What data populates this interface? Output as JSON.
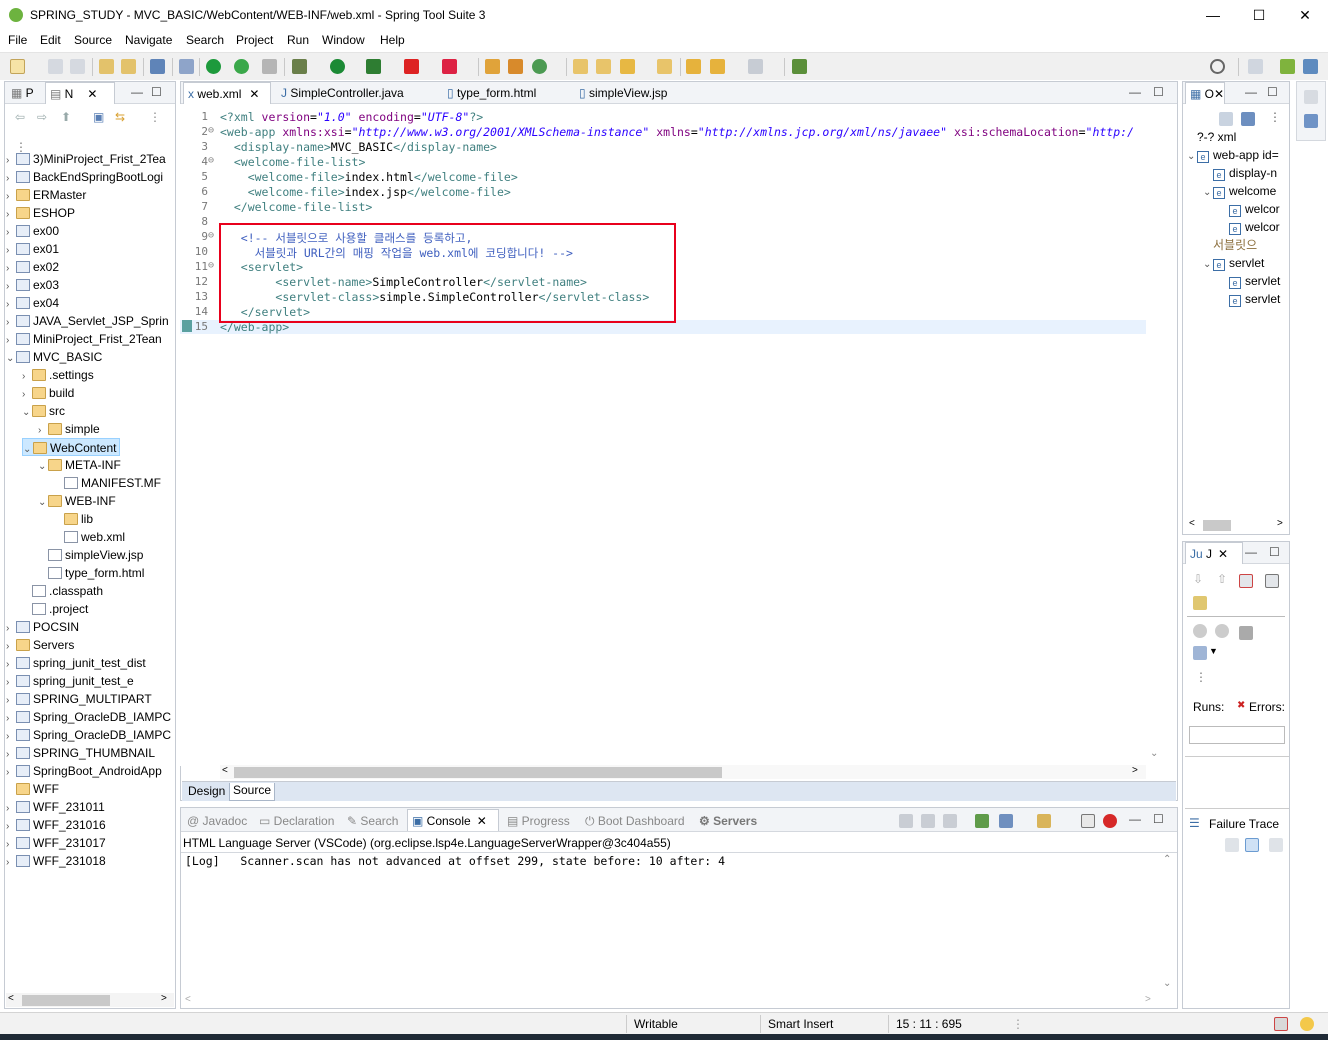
{
  "window": {
    "title": "SPRING_STUDY - MVC_BASIC/WebContent/WEB-INF/web.xml - Spring Tool Suite 3",
    "minimize": "—",
    "maximize": "☐",
    "close": "✕"
  },
  "menu": [
    "File",
    "Edit",
    "Source",
    "Navigate",
    "Search",
    "Project",
    "Run",
    "Window",
    "Help"
  ],
  "left_panel": {
    "tabs": [
      "P",
      "N"
    ],
    "tree": [
      {
        "label": "3)MiniProject_Frist_2Tea",
        "depth": 0,
        "chev": "›",
        "icon": "proj"
      },
      {
        "label": "BackEndSpringBootLogi",
        "depth": 0,
        "chev": "›",
        "icon": "proj"
      },
      {
        "label": "ERMaster",
        "depth": 0,
        "chev": "›",
        "icon": "fold"
      },
      {
        "label": "ESHOP",
        "depth": 0,
        "chev": "›",
        "icon": "fold"
      },
      {
        "label": "ex00",
        "depth": 0,
        "chev": "›",
        "icon": "proj"
      },
      {
        "label": "ex01",
        "depth": 0,
        "chev": "›",
        "icon": "proj"
      },
      {
        "label": "ex02",
        "depth": 0,
        "chev": "›",
        "icon": "proj"
      },
      {
        "label": "ex03",
        "depth": 0,
        "chev": "›",
        "icon": "proj"
      },
      {
        "label": "ex04",
        "depth": 0,
        "chev": "›",
        "icon": "proj"
      },
      {
        "label": "JAVA_Servlet_JSP_Sprin",
        "depth": 0,
        "chev": "›",
        "icon": "proj"
      },
      {
        "label": "MiniProject_Frist_2Tean",
        "depth": 0,
        "chev": "›",
        "icon": "proj"
      },
      {
        "label": "MVC_BASIC",
        "depth": 0,
        "chev": "⌄",
        "icon": "proj"
      },
      {
        "label": ".settings",
        "depth": 1,
        "chev": "›",
        "icon": "fold"
      },
      {
        "label": "build",
        "depth": 1,
        "chev": "›",
        "icon": "fold"
      },
      {
        "label": "src",
        "depth": 1,
        "chev": "⌄",
        "icon": "fold"
      },
      {
        "label": "simple",
        "depth": 2,
        "chev": "›",
        "icon": "fold"
      },
      {
        "label": "WebContent",
        "depth": 1,
        "chev": "⌄",
        "icon": "fold",
        "selected": true
      },
      {
        "label": "META-INF",
        "depth": 2,
        "chev": "⌄",
        "icon": "fold"
      },
      {
        "label": "MANIFEST.MF",
        "depth": 3,
        "chev": "",
        "icon": "file"
      },
      {
        "label": "WEB-INF",
        "depth": 2,
        "chev": "⌄",
        "icon": "fold"
      },
      {
        "label": "lib",
        "depth": 3,
        "chev": "",
        "icon": "fold"
      },
      {
        "label": "web.xml",
        "depth": 3,
        "chev": "",
        "icon": "file"
      },
      {
        "label": "simpleView.jsp",
        "depth": 2,
        "chev": "",
        "icon": "file"
      },
      {
        "label": "type_form.html",
        "depth": 2,
        "chev": "",
        "icon": "file"
      },
      {
        "label": ".classpath",
        "depth": 1,
        "chev": "",
        "icon": "file"
      },
      {
        "label": ".project",
        "depth": 1,
        "chev": "",
        "icon": "file"
      },
      {
        "label": "POCSIN",
        "depth": 0,
        "chev": "›",
        "icon": "proj"
      },
      {
        "label": "Servers",
        "depth": 0,
        "chev": "›",
        "icon": "fold"
      },
      {
        "label": "spring_junit_test_dist",
        "depth": 0,
        "chev": "›",
        "icon": "proj"
      },
      {
        "label": "spring_junit_test_e",
        "depth": 0,
        "chev": "›",
        "icon": "proj"
      },
      {
        "label": "SPRING_MULTIPART",
        "depth": 0,
        "chev": "›",
        "icon": "proj"
      },
      {
        "label": "Spring_OracleDB_IAMPC",
        "depth": 0,
        "chev": "›",
        "icon": "proj"
      },
      {
        "label": "Spring_OracleDB_IAMPC",
        "depth": 0,
        "chev": "›",
        "icon": "proj"
      },
      {
        "label": "SPRING_THUMBNAIL",
        "depth": 0,
        "chev": "›",
        "icon": "proj"
      },
      {
        "label": "SpringBoot_AndroidApp",
        "depth": 0,
        "chev": "›",
        "icon": "proj"
      },
      {
        "label": "WFF",
        "depth": 0,
        "chev": "",
        "icon": "fold"
      },
      {
        "label": "WFF_231011",
        "depth": 0,
        "chev": "›",
        "icon": "proj"
      },
      {
        "label": "WFF_231016",
        "depth": 0,
        "chev": "›",
        "icon": "proj"
      },
      {
        "label": "WFF_231017",
        "depth": 0,
        "chev": "›",
        "icon": "proj"
      },
      {
        "label": "WFF_231018",
        "depth": 0,
        "chev": "›",
        "icon": "proj"
      }
    ]
  },
  "editor": {
    "tabs": [
      {
        "label": "web.xml",
        "active": true,
        "close": "✕"
      },
      {
        "label": "SimpleController.java"
      },
      {
        "label": "type_form.html"
      },
      {
        "label": "simpleView.jsp"
      }
    ],
    "lines": [
      {
        "n": "1",
        "fold": "",
        "parts": [
          [
            "tag",
            "<?xml "
          ],
          [
            "attr",
            "version"
          ],
          [
            "txt",
            "="
          ],
          [
            "str",
            "\"1.0\""
          ],
          [
            "txt",
            " "
          ],
          [
            "attr",
            "encoding"
          ],
          [
            "txt",
            "="
          ],
          [
            "str",
            "\"UTF-8\""
          ],
          [
            "tag",
            "?>"
          ]
        ]
      },
      {
        "n": "2",
        "fold": "⊖",
        "parts": [
          [
            "tag",
            "<web-app "
          ],
          [
            "attr",
            "xmlns:xsi"
          ],
          [
            "txt",
            "="
          ],
          [
            "str",
            "\"http://www.w3.org/2001/XMLSchema-instance\""
          ],
          [
            "txt",
            " "
          ],
          [
            "attr",
            "xmlns"
          ],
          [
            "txt",
            "="
          ],
          [
            "str",
            "\"http://xmlns.jcp.org/xml/ns/javaee\""
          ],
          [
            "txt",
            " "
          ],
          [
            "attr",
            "xsi:schemaLocation"
          ],
          [
            "txt",
            "="
          ],
          [
            "str",
            "\"http:/"
          ]
        ]
      },
      {
        "n": "3",
        "fold": "",
        "parts": [
          [
            "txt",
            "  "
          ],
          [
            "tag",
            "<display-name>"
          ],
          [
            "txt",
            "MVC_BASIC"
          ],
          [
            "tag",
            "</display-name>"
          ]
        ]
      },
      {
        "n": "4",
        "fold": "⊖",
        "parts": [
          [
            "txt",
            "  "
          ],
          [
            "tag",
            "<welcome-file-list>"
          ]
        ]
      },
      {
        "n": "5",
        "fold": "",
        "parts": [
          [
            "txt",
            "    "
          ],
          [
            "tag",
            "<welcome-file>"
          ],
          [
            "txt",
            "index.html"
          ],
          [
            "tag",
            "</welcome-file>"
          ]
        ]
      },
      {
        "n": "6",
        "fold": "",
        "parts": [
          [
            "txt",
            "    "
          ],
          [
            "tag",
            "<welcome-file>"
          ],
          [
            "txt",
            "index.jsp"
          ],
          [
            "tag",
            "</welcome-file>"
          ]
        ]
      },
      {
        "n": "7",
        "fold": "",
        "parts": [
          [
            "txt",
            "  "
          ],
          [
            "tag",
            "</welcome-file-list>"
          ]
        ]
      },
      {
        "n": "8",
        "fold": "",
        "parts": []
      },
      {
        "n": "9",
        "fold": "⊖",
        "parts": [
          [
            "txt",
            "   "
          ],
          [
            "cm",
            "<!-- 서블릿으로 사용할 클래스를 등록하고,"
          ]
        ]
      },
      {
        "n": "10",
        "fold": "",
        "parts": [
          [
            "cm",
            "     서블릿과 URL간의 매핑 작업을 web.xml에 코딩합니다! -->"
          ]
        ]
      },
      {
        "n": "11",
        "fold": "⊖",
        "parts": [
          [
            "txt",
            "   "
          ],
          [
            "tag",
            "<servlet>"
          ]
        ]
      },
      {
        "n": "12",
        "fold": "",
        "parts": [
          [
            "txt",
            "        "
          ],
          [
            "tag",
            "<servlet-name>"
          ],
          [
            "txt",
            "SimpleController"
          ],
          [
            "tag",
            "</servlet-name>"
          ]
        ]
      },
      {
        "n": "13",
        "fold": "",
        "parts": [
          [
            "txt",
            "        "
          ],
          [
            "tag",
            "<servlet-class>"
          ],
          [
            "txt",
            "simple.SimpleController"
          ],
          [
            "tag",
            "</servlet-class>"
          ]
        ]
      },
      {
        "n": "14",
        "fold": "",
        "parts": [
          [
            "txt",
            "   "
          ],
          [
            "tag",
            "</servlet>"
          ]
        ]
      },
      {
        "n": "15",
        "fold": "",
        "parts": [
          [
            "tag",
            "</web-app>"
          ]
        ]
      }
    ],
    "bottom_tabs": [
      "Design",
      "Source"
    ]
  },
  "console": {
    "tabs": [
      "Javadoc",
      "Declaration",
      "Search",
      "Console",
      "Progress",
      "Boot Dashboard",
      "Servers"
    ],
    "header": "HTML Language Server (VSCode) (org.eclipse.lsp4e.LanguageServerWrapper@3c404a55)",
    "log": "[Log]   Scanner.scan has not advanced at offset 299, state before: 10 after: 4"
  },
  "outline": {
    "tab": "O",
    "items": [
      {
        "label": "?-? xml",
        "depth": 0,
        "chev": ""
      },
      {
        "label": "web-app id=",
        "depth": 0,
        "chev": "⌄",
        "e": true
      },
      {
        "label": "display-n",
        "depth": 1,
        "chev": "",
        "e": true
      },
      {
        "label": "welcome",
        "depth": 1,
        "chev": "⌄",
        "e": true
      },
      {
        "label": "welcor",
        "depth": 2,
        "chev": "",
        "e": true
      },
      {
        "label": "welcor",
        "depth": 2,
        "chev": "",
        "e": true
      },
      {
        "label": "서블릿으",
        "depth": 1,
        "chev": "",
        "e": false,
        "comment": true
      },
      {
        "label": "servlet",
        "depth": 1,
        "chev": "⌄",
        "e": true
      },
      {
        "label": "servlet",
        "depth": 2,
        "chev": "",
        "e": true
      },
      {
        "label": "servlet",
        "depth": 2,
        "chev": "",
        "e": true
      }
    ]
  },
  "junit": {
    "tab": "J",
    "runs": "Runs:",
    "errors": "Errors:",
    "failure_trace": "Failure Trace"
  },
  "status": {
    "writable": "Writable",
    "insert": "Smart Insert",
    "position": "15 : 11 : 695"
  }
}
